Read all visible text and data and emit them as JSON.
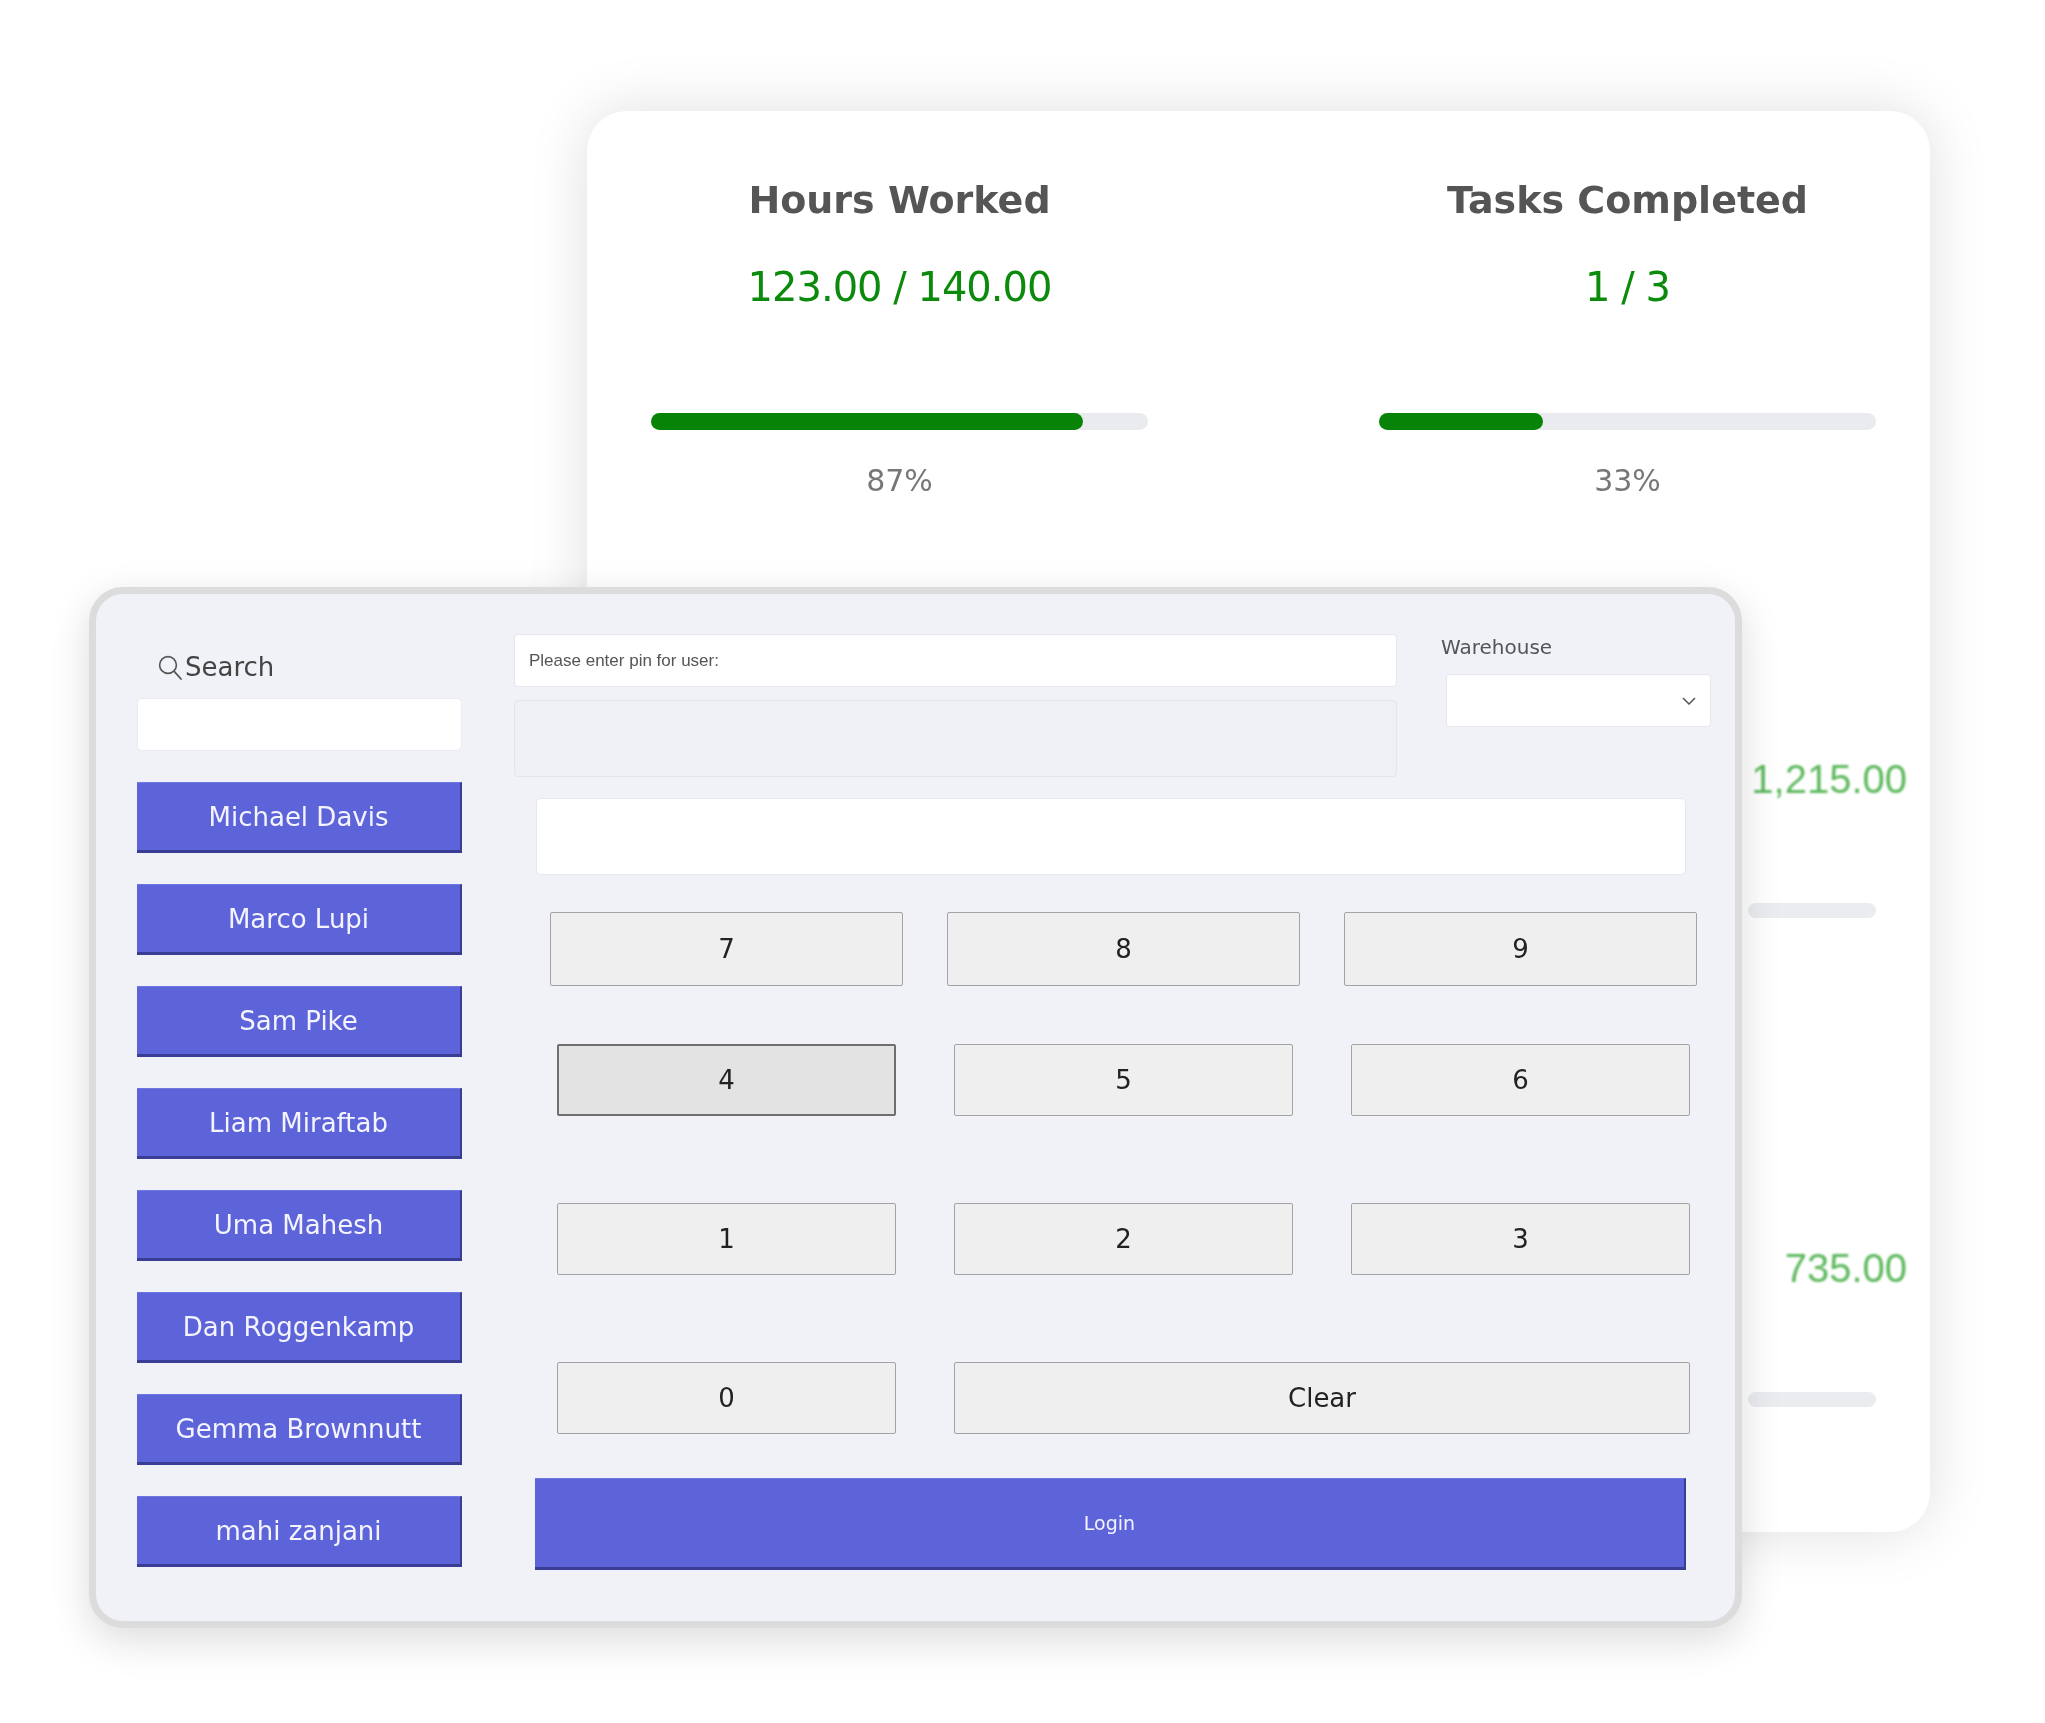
{
  "stats_card": {
    "stats": [
      {
        "title": "Hours Worked",
        "value": "123.00 / 140.00",
        "level": 0.87,
        "percent": "87%"
      },
      {
        "title": "Tasks Completed",
        "value": "1 / 3",
        "level": 0.33,
        "percent": "33%"
      }
    ],
    "lower_stats": [
      {
        "value": "1,215.00"
      },
      {
        "value": "735.00"
      }
    ]
  },
  "login_panel": {
    "search": {
      "label": "Search"
    },
    "users": [
      "Michael Davis",
      "Marco Lupi",
      "Sam Pike",
      "Liam Miraftab",
      "Uma Mahesh",
      "Dan Roggenkamp",
      "Gemma Brownnutt",
      "mahi zanjani"
    ],
    "pin_prompt": "Please enter pin for user:",
    "warehouse": {
      "label": "Warehouse"
    },
    "keypad": [
      [
        {
          "kind": "digit",
          "label": "7",
          "pressed": false
        },
        {
          "kind": "digit",
          "label": "8",
          "pressed": false
        },
        {
          "kind": "digit",
          "label": "9",
          "pressed": false
        }
      ],
      [
        {
          "kind": "digit",
          "label": "4",
          "pressed": true
        },
        {
          "kind": "digit",
          "label": "5",
          "pressed": false
        },
        {
          "kind": "digit",
          "label": "6",
          "pressed": false
        }
      ],
      [
        {
          "kind": "digit",
          "label": "1",
          "pressed": false
        },
        {
          "kind": "digit",
          "label": "2",
          "pressed": false
        },
        {
          "kind": "digit",
          "label": "3",
          "pressed": false
        }
      ],
      [
        {
          "kind": "digit",
          "label": "0",
          "pressed": false
        },
        {
          "kind": "clear",
          "label": "Clear",
          "pressed": false
        }
      ]
    ],
    "login_button": "Login"
  }
}
